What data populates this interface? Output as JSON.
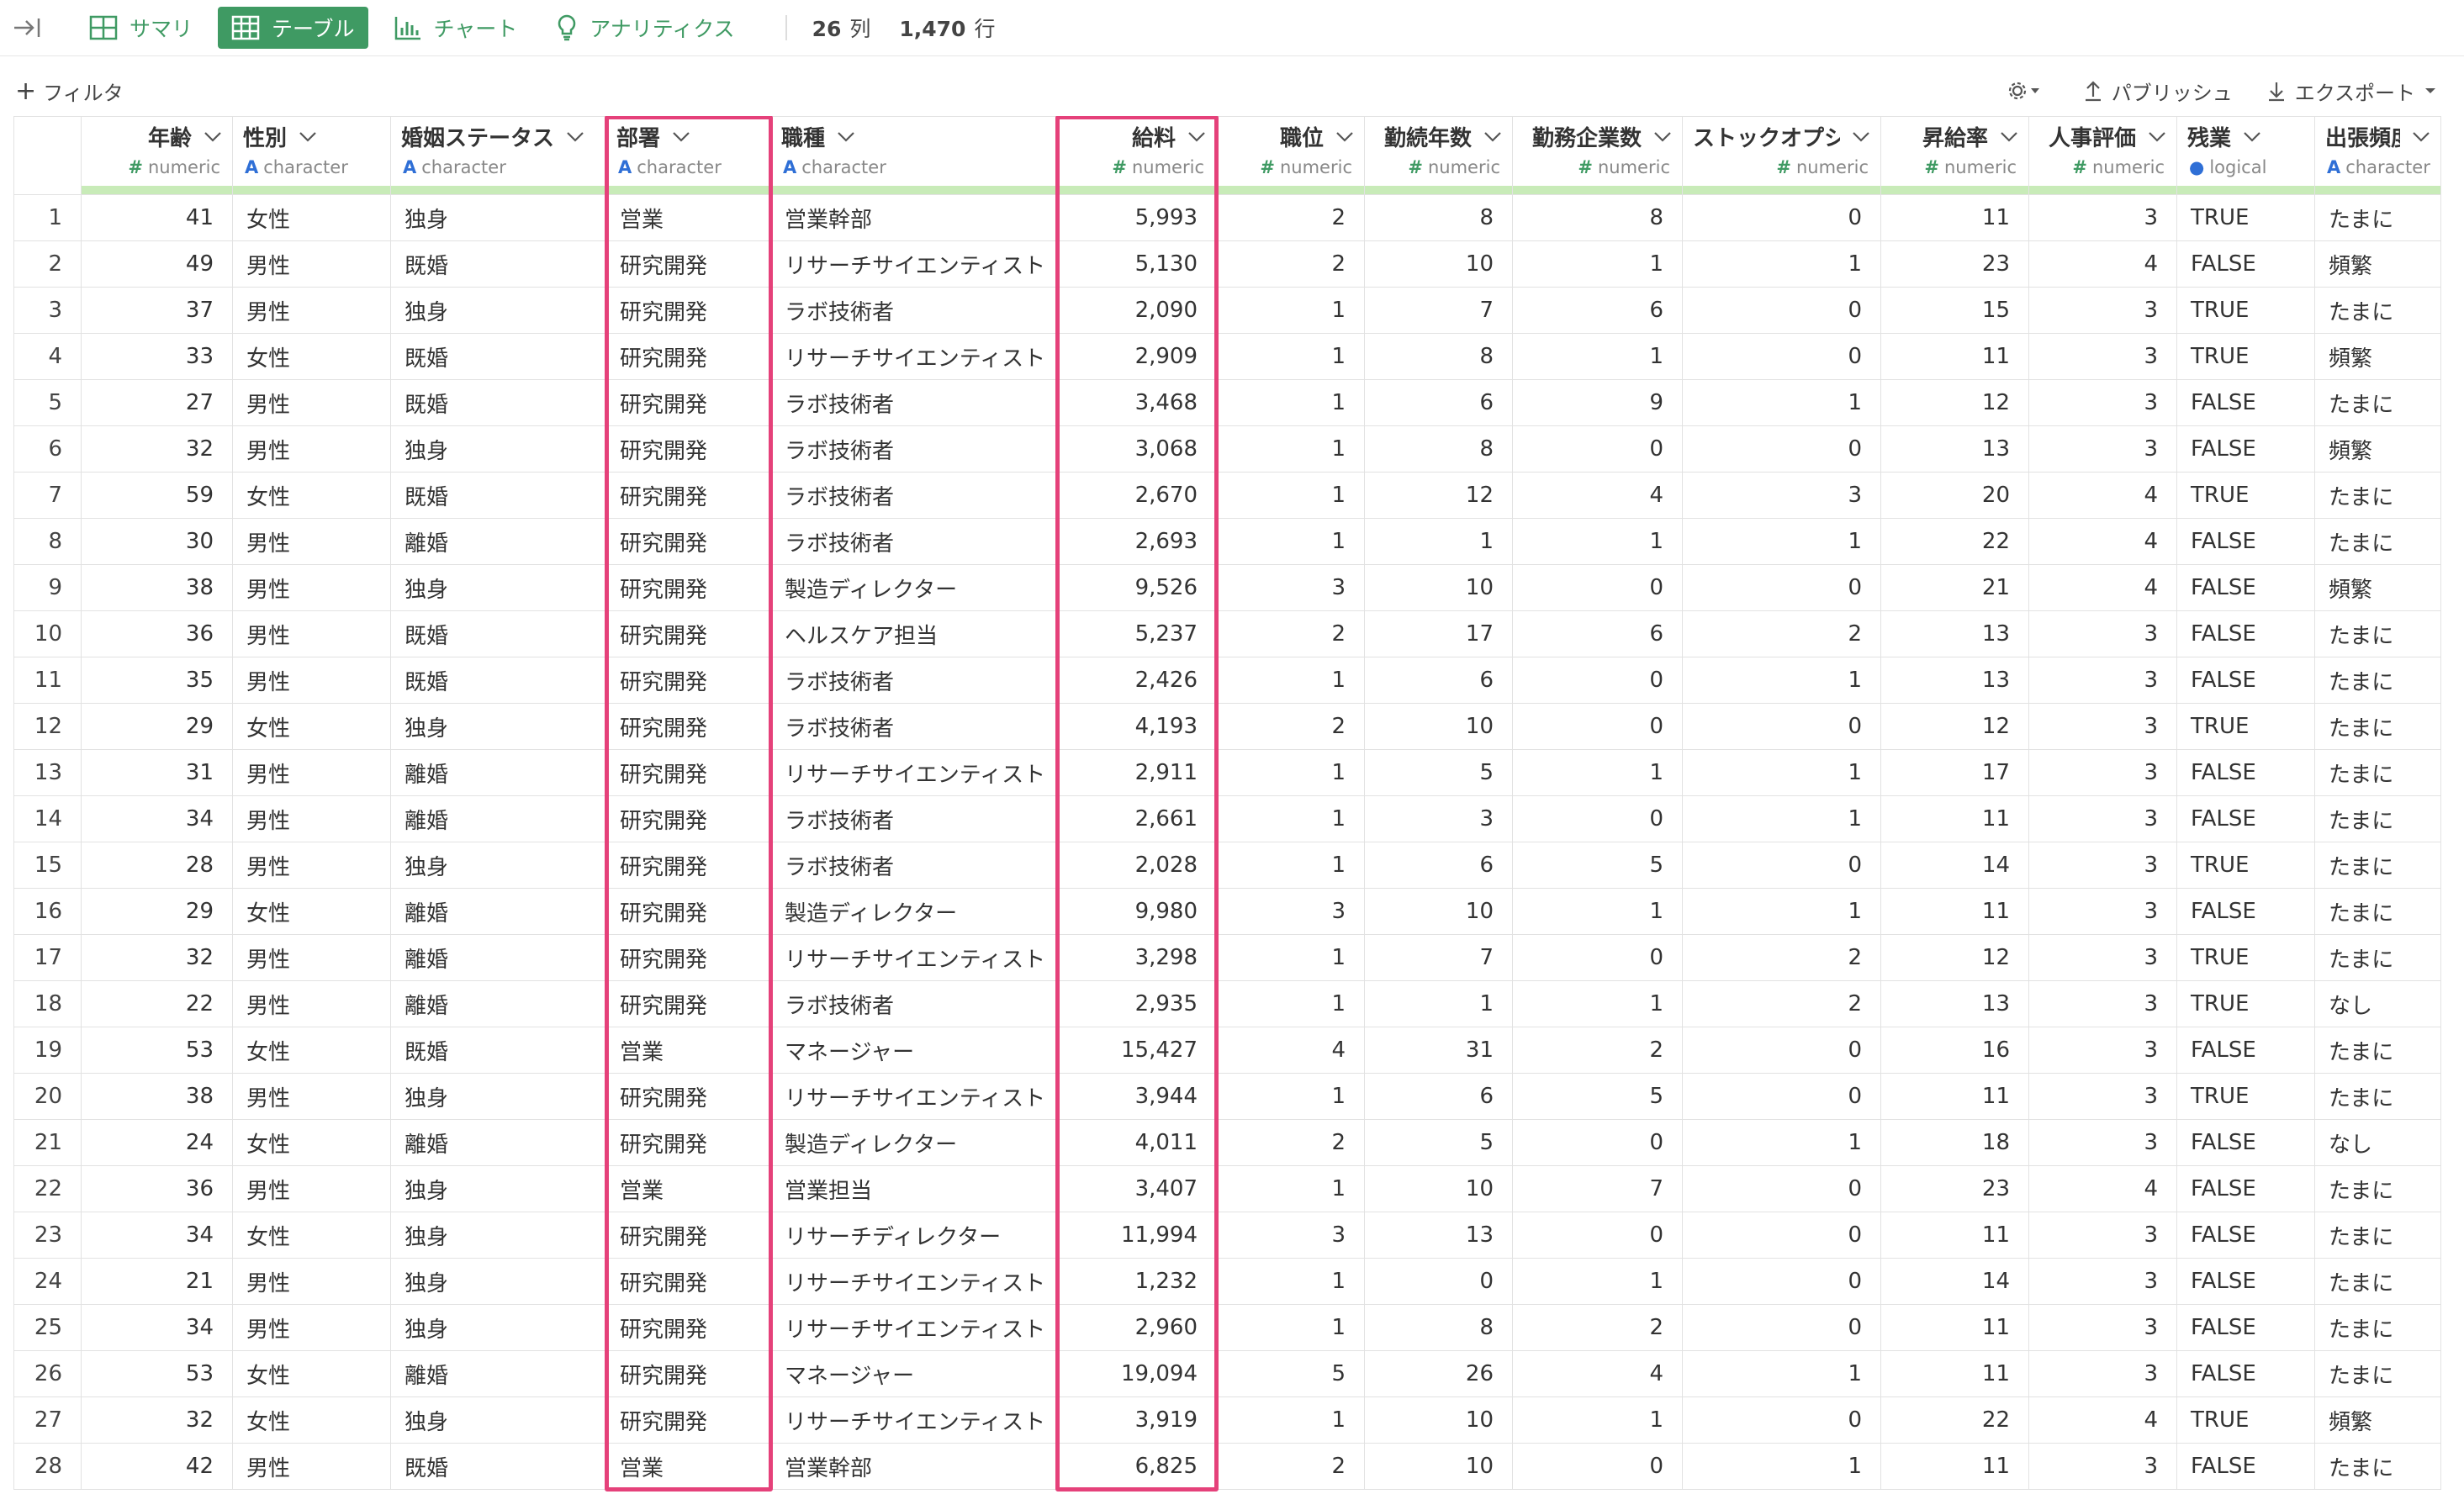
{
  "toolbar": {
    "summary_label": "サマリ",
    "table_label": "テーブル",
    "chart_label": "チャート",
    "analytics_label": "アナリティクス",
    "columns_count": "26",
    "columns_unit": "列",
    "rows_count": "1,470",
    "rows_unit": "行",
    "accent_color": "#3f9a63"
  },
  "subbar": {
    "filter_label": "フィルタ",
    "publish_label": "パブリッシュ",
    "export_label": "エクスポート"
  },
  "columns": [
    {
      "name": "年齢",
      "type": "numeric"
    },
    {
      "name": "性別",
      "type": "character"
    },
    {
      "name": "婚姻ステータス",
      "type": "character"
    },
    {
      "name": "部署",
      "type": "character"
    },
    {
      "name": "職種",
      "type": "character"
    },
    {
      "name": "給料",
      "type": "numeric"
    },
    {
      "name": "職位",
      "type": "numeric"
    },
    {
      "name": "勤続年数",
      "type": "numeric"
    },
    {
      "name": "勤務企業数",
      "type": "numeric"
    },
    {
      "name": "ストックオプション",
      "type": "numeric"
    },
    {
      "name": "昇給率",
      "type": "numeric"
    },
    {
      "name": "人事評価",
      "type": "numeric"
    },
    {
      "name": "残業",
      "type": "logical"
    },
    {
      "name": "出張頻度",
      "type": "character"
    }
  ],
  "rows": [
    [
      "1",
      "41",
      "女性",
      "独身",
      "営業",
      "営業幹部",
      "5,993",
      "2",
      "8",
      "8",
      "0",
      "11",
      "3",
      "TRUE",
      "たまに"
    ],
    [
      "2",
      "49",
      "男性",
      "既婚",
      "研究開発",
      "リサーチサイエンティスト",
      "5,130",
      "2",
      "10",
      "1",
      "1",
      "23",
      "4",
      "FALSE",
      "頻繁"
    ],
    [
      "3",
      "37",
      "男性",
      "独身",
      "研究開発",
      "ラボ技術者",
      "2,090",
      "1",
      "7",
      "6",
      "0",
      "15",
      "3",
      "TRUE",
      "たまに"
    ],
    [
      "4",
      "33",
      "女性",
      "既婚",
      "研究開発",
      "リサーチサイエンティスト",
      "2,909",
      "1",
      "8",
      "1",
      "0",
      "11",
      "3",
      "TRUE",
      "頻繁"
    ],
    [
      "5",
      "27",
      "男性",
      "既婚",
      "研究開発",
      "ラボ技術者",
      "3,468",
      "1",
      "6",
      "9",
      "1",
      "12",
      "3",
      "FALSE",
      "たまに"
    ],
    [
      "6",
      "32",
      "男性",
      "独身",
      "研究開発",
      "ラボ技術者",
      "3,068",
      "1",
      "8",
      "0",
      "0",
      "13",
      "3",
      "FALSE",
      "頻繁"
    ],
    [
      "7",
      "59",
      "女性",
      "既婚",
      "研究開発",
      "ラボ技術者",
      "2,670",
      "1",
      "12",
      "4",
      "3",
      "20",
      "4",
      "TRUE",
      "たまに"
    ],
    [
      "8",
      "30",
      "男性",
      "離婚",
      "研究開発",
      "ラボ技術者",
      "2,693",
      "1",
      "1",
      "1",
      "1",
      "22",
      "4",
      "FALSE",
      "たまに"
    ],
    [
      "9",
      "38",
      "男性",
      "独身",
      "研究開発",
      "製造ディレクター",
      "9,526",
      "3",
      "10",
      "0",
      "0",
      "21",
      "4",
      "FALSE",
      "頻繁"
    ],
    [
      "10",
      "36",
      "男性",
      "既婚",
      "研究開発",
      "ヘルスケア担当",
      "5,237",
      "2",
      "17",
      "6",
      "2",
      "13",
      "3",
      "FALSE",
      "たまに"
    ],
    [
      "11",
      "35",
      "男性",
      "既婚",
      "研究開発",
      "ラボ技術者",
      "2,426",
      "1",
      "6",
      "0",
      "1",
      "13",
      "3",
      "FALSE",
      "たまに"
    ],
    [
      "12",
      "29",
      "女性",
      "独身",
      "研究開発",
      "ラボ技術者",
      "4,193",
      "2",
      "10",
      "0",
      "0",
      "12",
      "3",
      "TRUE",
      "たまに"
    ],
    [
      "13",
      "31",
      "男性",
      "離婚",
      "研究開発",
      "リサーチサイエンティスト",
      "2,911",
      "1",
      "5",
      "1",
      "1",
      "17",
      "3",
      "FALSE",
      "たまに"
    ],
    [
      "14",
      "34",
      "男性",
      "離婚",
      "研究開発",
      "ラボ技術者",
      "2,661",
      "1",
      "3",
      "0",
      "1",
      "11",
      "3",
      "FALSE",
      "たまに"
    ],
    [
      "15",
      "28",
      "男性",
      "独身",
      "研究開発",
      "ラボ技術者",
      "2,028",
      "1",
      "6",
      "5",
      "0",
      "14",
      "3",
      "TRUE",
      "たまに"
    ],
    [
      "16",
      "29",
      "女性",
      "離婚",
      "研究開発",
      "製造ディレクター",
      "9,980",
      "3",
      "10",
      "1",
      "1",
      "11",
      "3",
      "FALSE",
      "たまに"
    ],
    [
      "17",
      "32",
      "男性",
      "離婚",
      "研究開発",
      "リサーチサイエンティスト",
      "3,298",
      "1",
      "7",
      "0",
      "2",
      "12",
      "3",
      "TRUE",
      "たまに"
    ],
    [
      "18",
      "22",
      "男性",
      "離婚",
      "研究開発",
      "ラボ技術者",
      "2,935",
      "1",
      "1",
      "1",
      "2",
      "13",
      "3",
      "TRUE",
      "なし"
    ],
    [
      "19",
      "53",
      "女性",
      "既婚",
      "営業",
      "マネージャー",
      "15,427",
      "4",
      "31",
      "2",
      "0",
      "16",
      "3",
      "FALSE",
      "たまに"
    ],
    [
      "20",
      "38",
      "男性",
      "独身",
      "研究開発",
      "リサーチサイエンティスト",
      "3,944",
      "1",
      "6",
      "5",
      "0",
      "11",
      "3",
      "TRUE",
      "たまに"
    ],
    [
      "21",
      "24",
      "女性",
      "離婚",
      "研究開発",
      "製造ディレクター",
      "4,011",
      "2",
      "5",
      "0",
      "1",
      "18",
      "3",
      "FALSE",
      "なし"
    ],
    [
      "22",
      "36",
      "男性",
      "独身",
      "営業",
      "営業担当",
      "3,407",
      "1",
      "10",
      "7",
      "0",
      "23",
      "4",
      "FALSE",
      "たまに"
    ],
    [
      "23",
      "34",
      "女性",
      "独身",
      "研究開発",
      "リサーチディレクター",
      "11,994",
      "3",
      "13",
      "0",
      "0",
      "11",
      "3",
      "FALSE",
      "たまに"
    ],
    [
      "24",
      "21",
      "男性",
      "独身",
      "研究開発",
      "リサーチサイエンティスト",
      "1,232",
      "1",
      "0",
      "1",
      "0",
      "14",
      "3",
      "FALSE",
      "たまに"
    ],
    [
      "25",
      "34",
      "男性",
      "独身",
      "研究開発",
      "リサーチサイエンティスト",
      "2,960",
      "1",
      "8",
      "2",
      "0",
      "11",
      "3",
      "FALSE",
      "たまに"
    ],
    [
      "26",
      "53",
      "女性",
      "離婚",
      "研究開発",
      "マネージャー",
      "19,094",
      "5",
      "26",
      "4",
      "1",
      "11",
      "3",
      "FALSE",
      "たまに"
    ],
    [
      "27",
      "32",
      "女性",
      "独身",
      "研究開発",
      "リサーチサイエンティスト",
      "3,919",
      "1",
      "10",
      "1",
      "0",
      "22",
      "4",
      "TRUE",
      "頻繁"
    ],
    [
      "28",
      "42",
      "男性",
      "既婚",
      "営業",
      "営業幹部",
      "6,825",
      "2",
      "10",
      "0",
      "1",
      "11",
      "3",
      "FALSE",
      "たまに"
    ]
  ],
  "highlighted_columns": [
    "部署",
    "給料"
  ],
  "highlight_color": "#e5417a"
}
